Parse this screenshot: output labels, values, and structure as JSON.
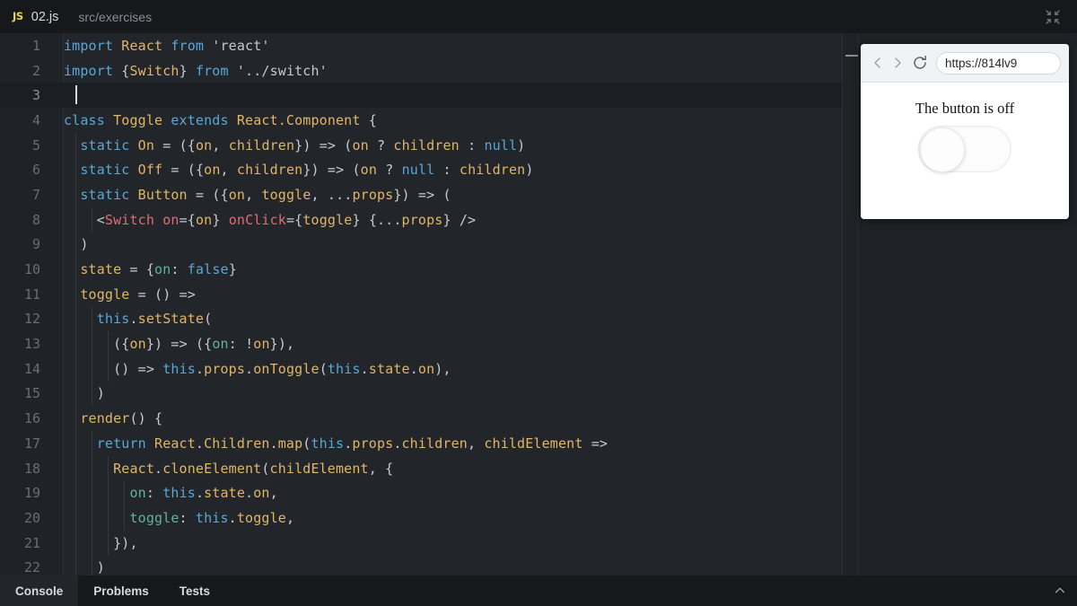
{
  "titlebar": {
    "badge": "JS",
    "file_name": "02.js",
    "file_path": "src/exercises",
    "collapse_icon": "collapse-arrows-icon"
  },
  "editor": {
    "cursor_line": 3,
    "active_line": 3,
    "minimize_icon": "minimize-dash-icon",
    "lines": [
      {
        "n": "1",
        "html": "<span class='kw'>import</span> <span class='fn'>React</span> <span class='kw'>from</span> <span class='str'>'react'</span>",
        "indent": 0
      },
      {
        "n": "2",
        "html": "<span class='kw'>import</span> <span class='pn'>{</span><span class='fn'>Switch</span><span class='pn'>}</span> <span class='kw'>from</span> <span class='str'>'../switch'</span>",
        "indent": 0
      },
      {
        "n": "3",
        "html": "",
        "indent": 0
      },
      {
        "n": "4",
        "html": "<span class='kw'>class</span> <span class='fn'>Toggle</span> <span class='kw'>extends</span> <span class='fn'>React.Component</span> <span class='pn'>{</span>",
        "indent": 0
      },
      {
        "n": "5",
        "html": "  <span class='kw'>static</span> <span class='fn'>On</span> <span class='op'>=</span> <span class='pn'>(</span><span class='pn'>{</span><span class='fn'>on</span><span class='pn'>,</span> <span class='fn'>children</span><span class='pn'>}</span><span class='pn'>)</span> <span class='op'>=&gt;</span> <span class='pn'>(</span><span class='fn'>on</span> <span class='op'>?</span> <span class='fn'>children</span> <span class='op'>:</span> <span class='lit'>null</span><span class='pn'>)</span>",
        "indent": 1
      },
      {
        "n": "6",
        "html": "  <span class='kw'>static</span> <span class='fn'>Off</span> <span class='op'>=</span> <span class='pn'>(</span><span class='pn'>{</span><span class='fn'>on</span><span class='pn'>,</span> <span class='fn'>children</span><span class='pn'>}</span><span class='pn'>)</span> <span class='op'>=&gt;</span> <span class='pn'>(</span><span class='fn'>on</span> <span class='op'>?</span> <span class='lit'>null</span> <span class='op'>:</span> <span class='fn'>children</span><span class='pn'>)</span>",
        "indent": 1
      },
      {
        "n": "7",
        "html": "  <span class='kw'>static</span> <span class='fn'>Button</span> <span class='op'>=</span> <span class='pn'>(</span><span class='pn'>{</span><span class='fn'>on</span><span class='pn'>,</span> <span class='fn'>toggle</span><span class='pn'>,</span> <span class='op'>...</span><span class='fn'>props</span><span class='pn'>}</span><span class='pn'>)</span> <span class='op'>=&gt;</span> <span class='pn'>(</span>",
        "indent": 1
      },
      {
        "n": "8",
        "html": "    <span class='pn'>&lt;</span><span class='tag'>Switch</span> <span class='tag'>on</span><span class='op'>=</span><span class='pn'>{</span><span class='fn'>on</span><span class='pn'>}</span> <span class='tag'>onClick</span><span class='op'>=</span><span class='pn'>{</span><span class='fn'>toggle</span><span class='pn'>}</span> <span class='pn'>{</span><span class='op'>...</span><span class='fn'>props</span><span class='pn'>}</span> <span class='pn'>/&gt;</span>",
        "indent": 2
      },
      {
        "n": "9",
        "html": "  <span class='pn'>)</span>",
        "indent": 1
      },
      {
        "n": "10",
        "html": "  <span class='fn'>state</span> <span class='op'>=</span> <span class='pn'>{</span><span class='key'>on</span><span class='pn'>:</span> <span class='lit'>false</span><span class='pn'>}</span>",
        "indent": 1
      },
      {
        "n": "11",
        "html": "  <span class='fn'>toggle</span> <span class='op'>=</span> <span class='pn'>()</span> <span class='op'>=&gt;</span>",
        "indent": 1
      },
      {
        "n": "12",
        "html": "    <span class='lit'>this</span><span class='pn'>.</span><span class='fn'>setState</span><span class='pn'>(</span>",
        "indent": 2
      },
      {
        "n": "13",
        "html": "      <span class='pn'>(</span><span class='pn'>{</span><span class='fn'>on</span><span class='pn'>}</span><span class='pn'>)</span> <span class='op'>=&gt;</span> <span class='pn'>(</span><span class='pn'>{</span><span class='key'>on</span><span class='pn'>:</span> <span class='op'>!</span><span class='fn'>on</span><span class='pn'>}</span><span class='pn'>)</span><span class='pn'>,</span>",
        "indent": 3
      },
      {
        "n": "14",
        "html": "      <span class='pn'>()</span> <span class='op'>=&gt;</span> <span class='lit'>this</span><span class='pn'>.</span><span class='fn'>props</span><span class='pn'>.</span><span class='fn'>onToggle</span><span class='pn'>(</span><span class='lit'>this</span><span class='pn'>.</span><span class='fn'>state</span><span class='pn'>.</span><span class='fn'>on</span><span class='pn'>)</span><span class='pn'>,</span>",
        "indent": 3
      },
      {
        "n": "15",
        "html": "    <span class='pn'>)</span>",
        "indent": 2
      },
      {
        "n": "16",
        "html": "  <span class='fn'>render</span><span class='pn'>()</span> <span class='pn'>{</span>",
        "indent": 1
      },
      {
        "n": "17",
        "html": "    <span class='kw'>return</span> <span class='fn'>React</span><span class='pn'>.</span><span class='fn'>Children</span><span class='pn'>.</span><span class='fn'>map</span><span class='pn'>(</span><span class='lit'>this</span><span class='pn'>.</span><span class='fn'>props</span><span class='pn'>.</span><span class='fn'>children</span><span class='pn'>,</span> <span class='fn'>childElement</span> <span class='op'>=&gt;</span>",
        "indent": 2
      },
      {
        "n": "18",
        "html": "      <span class='fn'>React</span><span class='pn'>.</span><span class='fn'>cloneElement</span><span class='pn'>(</span><span class='fn'>childElement</span><span class='pn'>,</span> <span class='pn'>{</span>",
        "indent": 3
      },
      {
        "n": "19",
        "html": "        <span class='key'>on</span><span class='pn'>:</span> <span class='lit'>this</span><span class='pn'>.</span><span class='fn'>state</span><span class='pn'>.</span><span class='fn'>on</span><span class='pn'>,</span>",
        "indent": 4
      },
      {
        "n": "20",
        "html": "        <span class='key'>toggle</span><span class='pn'>:</span> <span class='lit'>this</span><span class='pn'>.</span><span class='fn'>toggle</span><span class='pn'>,</span>",
        "indent": 4
      },
      {
        "n": "21",
        "html": "      <span class='pn'>}</span><span class='pn'>)</span><span class='pn'>,</span>",
        "indent": 3
      },
      {
        "n": "22",
        "html": "    <span class='pn'>)</span>",
        "indent": 2
      }
    ]
  },
  "preview": {
    "back_icon": "chevron-left-icon",
    "forward_icon": "chevron-right-icon",
    "reload_icon": "reload-icon",
    "url": "https://814lv9",
    "label": "The button is off",
    "toggle_state": "off"
  },
  "bottom_tabs": {
    "tabs": [
      {
        "label": "Console",
        "active": true
      },
      {
        "label": "Problems",
        "active": false
      },
      {
        "label": "Tests",
        "active": false
      }
    ],
    "chevron_icon": "chevron-up-icon"
  },
  "colors": {
    "editor_bg": "#22252a",
    "chrome_bg": "#16181c",
    "gutter_bg": "#1f2226",
    "active_line": "#1b1e22",
    "keyword": "#5aa7d6",
    "identifier": "#e2b567",
    "jsx_tag": "#e06c75",
    "object_key": "#5fb3a1",
    "js_badge": "#e8d44d"
  }
}
